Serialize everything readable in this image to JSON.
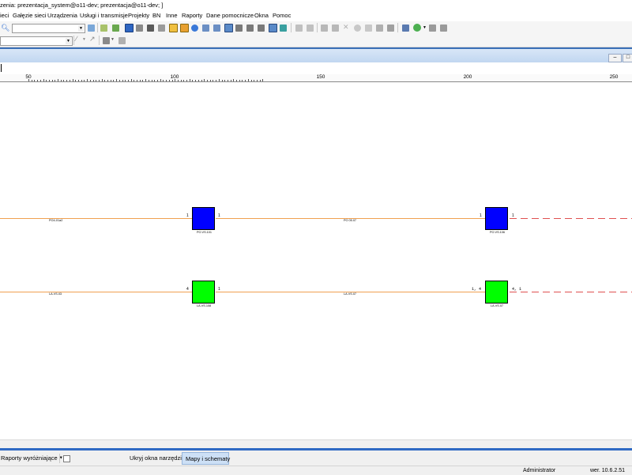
{
  "window": {
    "title": "zenia: prezentacja_system@o11-dev; prezentacja@o11-dev; ]"
  },
  "menu": {
    "items": [
      "ieci",
      "Gałęzie sieci",
      "Urządzenia",
      "Usługi i transmisje",
      "Projekty",
      "BN",
      "Inne",
      "Raporty",
      "Dane pomocnicze",
      "Okna",
      "Pomoc"
    ]
  },
  "toolbar": {
    "combo_value": "",
    "combo2_value": ""
  },
  "ruler": {
    "labels": [
      "50",
      "100",
      "150",
      "200",
      "250"
    ]
  },
  "canvas": {
    "row1": {
      "left_line_label": "PO4-01a2",
      "mid_line_label": "PO 05.07",
      "node1": {
        "port_left": "1",
        "port_right": "1",
        "label": "PO.VS.101",
        "color": "#0000ff"
      },
      "node2": {
        "port_left": "1",
        "port_right": "1",
        "label": "PO.VS.106",
        "color": "#0000ff"
      }
    },
    "row2": {
      "left_line_label": "LA.VS.03",
      "mid_line_label": "LA.VS.07",
      "node1": {
        "port_left": "4",
        "port_right": "1",
        "label": "LA.VS.108",
        "color": "#00ff00"
      },
      "node2": {
        "port_left": "1, 4",
        "port_right": "4, 1",
        "label": "LA.VS.07",
        "color": "#00ff00"
      }
    }
  },
  "bottom": {
    "reports_dropdown": "Raporty wyróżniające",
    "hide_tools": "Ukryj okna narzędzi",
    "maps_tab": "Mapy i schematy"
  },
  "status": {
    "user": "Administrator",
    "version": "wer. 10.6.2.51"
  },
  "colors": {
    "line_orange": "#f0a050",
    "line_dashed_red": "#e05050",
    "accent_blue": "#2f6ac4"
  }
}
